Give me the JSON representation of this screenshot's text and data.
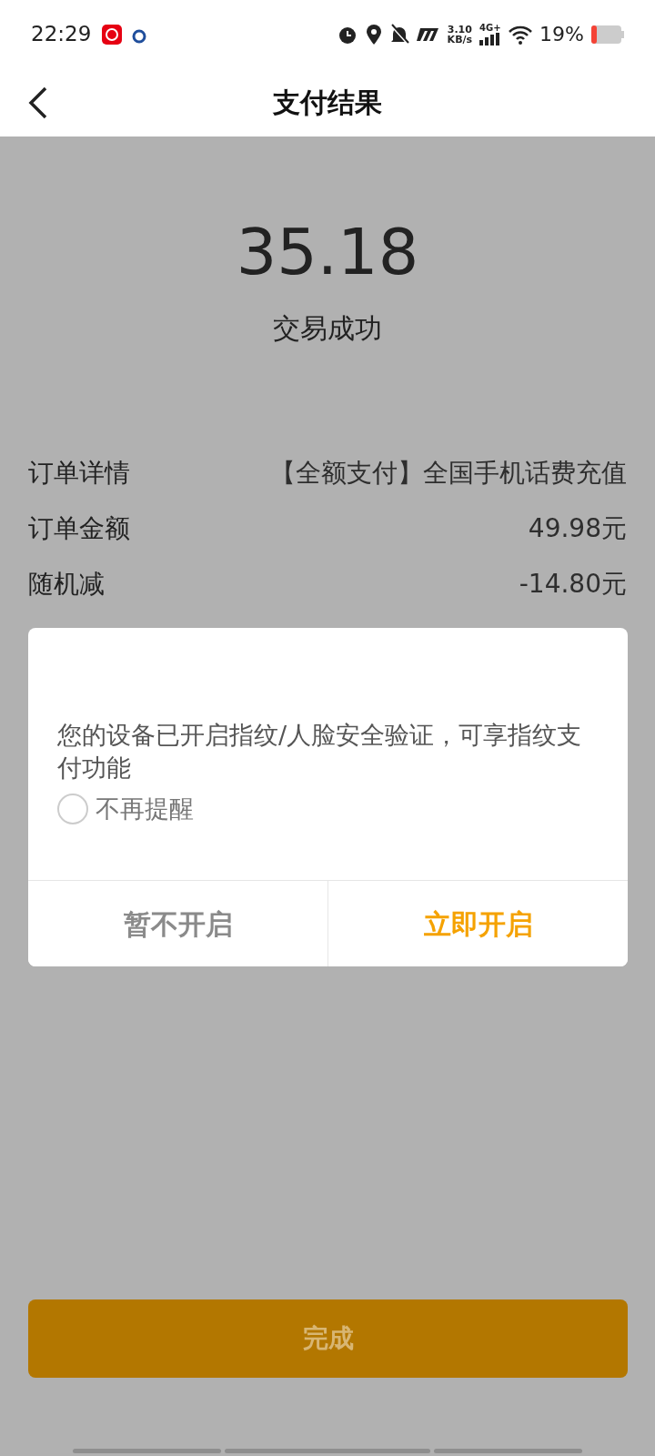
{
  "status_bar": {
    "time": "22:29",
    "net_speed": "3.10",
    "net_unit": "KB/s",
    "network": "4G+",
    "battery": "19%"
  },
  "header": {
    "title": "支付结果"
  },
  "result": {
    "amount": "35.18",
    "status": "交易成功"
  },
  "details": [
    {
      "label": "订单详情",
      "value": "【全额支付】全国手机话费充值"
    },
    {
      "label": "订单金额",
      "value": "49.98元"
    },
    {
      "label": "随机减",
      "value": "-14.80元"
    }
  ],
  "dialog": {
    "message": "您的设备已开启指纹/人脸安全验证，可享指纹支付功能",
    "dont_remind": {
      "label": "不再提醒",
      "checked": false
    },
    "buttons": [
      {
        "label": "暂不开启",
        "kind": "secondary"
      },
      {
        "label": "立即开启",
        "kind": "primary"
      }
    ]
  },
  "done_button": {
    "label": "完成"
  }
}
